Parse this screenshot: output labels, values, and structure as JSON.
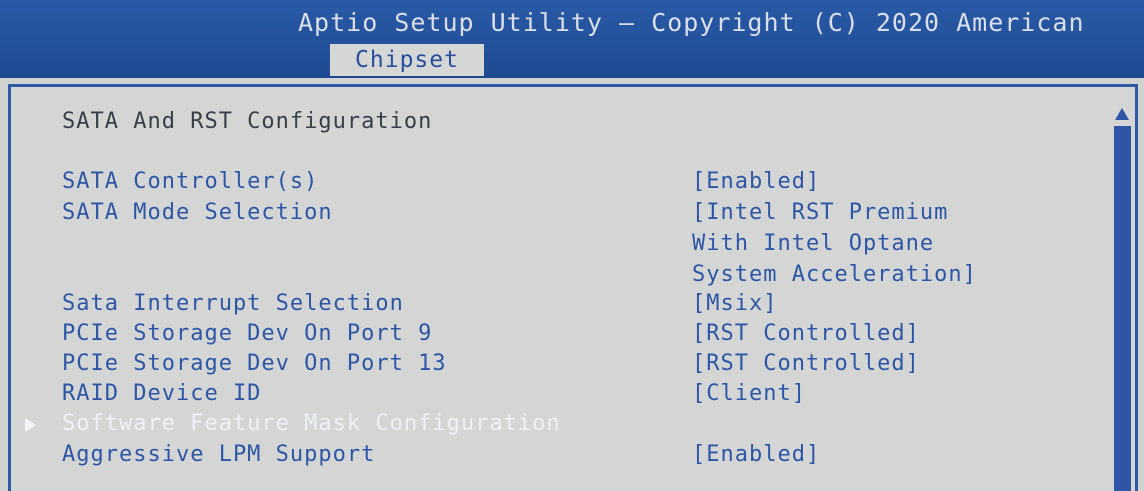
{
  "header": {
    "title": "Aptio Setup Utility – Copyright (C) 2020 American",
    "tab": "Chipset"
  },
  "page": {
    "section_title": "SATA And RST Configuration"
  },
  "settings": [
    {
      "label": "SATA Controller(s)",
      "value": "[Enabled]"
    },
    {
      "label": "SATA Mode Selection",
      "value_lines": [
        "[Intel RST Premium",
        "With Intel Optane",
        "System Acceleration]"
      ]
    },
    {
      "label": "Sata Interrupt Selection",
      "value": "[Msix]"
    },
    {
      "label": "PCIe Storage Dev On Port 9",
      "value": "[RST Controlled]"
    },
    {
      "label": "PCIe Storage Dev On Port 13",
      "value": "[RST Controlled]"
    },
    {
      "label": "RAID Device ID",
      "value": "[Client]"
    },
    {
      "label": "Software Feature Mask Configuration",
      "submenu": true,
      "selected": true
    },
    {
      "label": "Aggressive LPM Support",
      "value": "[Enabled]"
    }
  ],
  "colors": {
    "header_bg": "#1f4a92",
    "panel_bg": "#d3d6d5",
    "accent_blue": "#2f56a6",
    "selected_text": "#eef1f6"
  },
  "icons": {
    "submenu": "submenu-arrow-icon",
    "scroll_up": "scroll-up-arrow-icon"
  }
}
